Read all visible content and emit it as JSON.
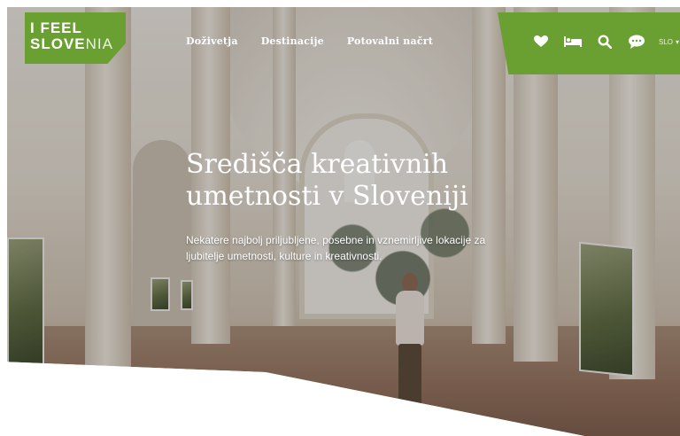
{
  "brand": {
    "logo_line1": "I FEEL",
    "logo_line2_bold": "SLOVE",
    "logo_line2_light": "NIA",
    "accent_color": "#6aa032"
  },
  "nav": {
    "items": [
      {
        "label": "Doživetja"
      },
      {
        "label": "Destinacije"
      },
      {
        "label": "Potovalni načrt"
      }
    ]
  },
  "utility": {
    "icons": [
      "heart-icon",
      "bed-icon",
      "search-icon",
      "chat-icon"
    ],
    "language": "SLO"
  },
  "hero": {
    "title": "Središča kreativnih umetnosti v Sloveniji",
    "subtitle": "Nekatere najbolj priljubljene, posebne in vznemirljive lokacije za ljubitelje umetnosti, kulture in kreativnosti."
  }
}
